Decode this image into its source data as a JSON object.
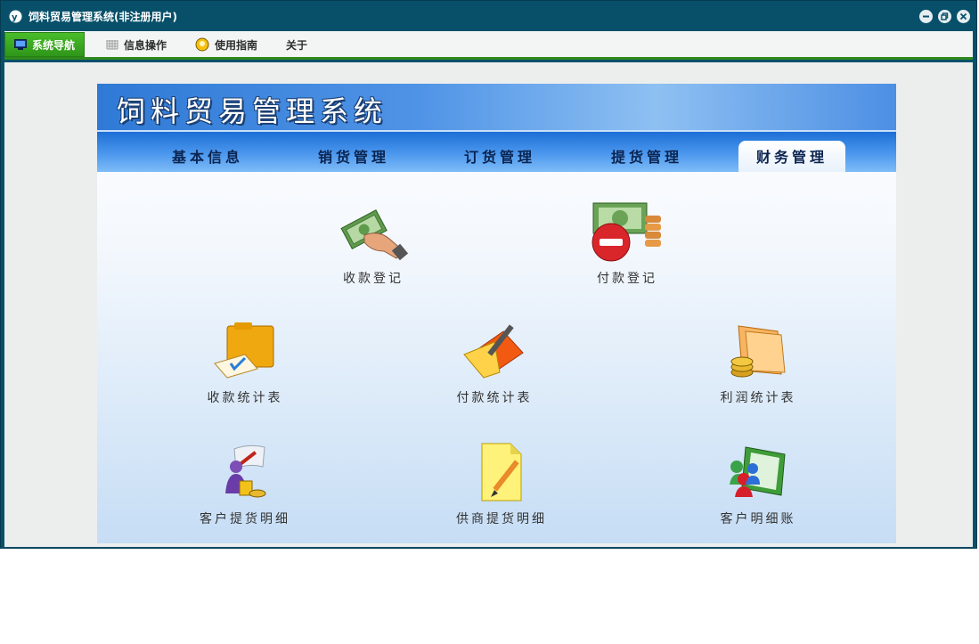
{
  "window": {
    "title": "饲料贸易管理系统(非注册用户)",
    "controls": [
      "minimize-icon",
      "restore-icon",
      "close-icon"
    ]
  },
  "menubar": {
    "items": [
      {
        "label": "系统导航",
        "icon": "monitor-icon",
        "active": true
      },
      {
        "label": "信息操作",
        "icon": "grid-icon",
        "active": false
      },
      {
        "label": "使用指南",
        "icon": "bulb-icon",
        "active": false
      },
      {
        "label": "关于",
        "icon": "",
        "active": false
      }
    ],
    "accent": "#2f8a1c"
  },
  "banner": {
    "title": "饲料贸易管理系统"
  },
  "tabs": [
    {
      "label": "基本信息",
      "active": false
    },
    {
      "label": "销货管理",
      "active": false
    },
    {
      "label": "订货管理",
      "active": false
    },
    {
      "label": "提货管理",
      "active": false
    },
    {
      "label": "财务管理",
      "active": true
    }
  ],
  "finance": {
    "items": [
      {
        "label": "收款登记",
        "icon": "money-hand-icon"
      },
      {
        "label": "付款登记",
        "icon": "money-minus-icon"
      },
      {
        "label": "收款统计表",
        "icon": "folder-check-icon"
      },
      {
        "label": "付款统计表",
        "icon": "folder-pen-icon"
      },
      {
        "label": "利润统计表",
        "icon": "folder-coins-icon"
      },
      {
        "label": "客户提货明细",
        "icon": "person-scroll-icon"
      },
      {
        "label": "供商提货明细",
        "icon": "note-pencil-icon"
      },
      {
        "label": "客户明细账",
        "icon": "ledger-people-icon"
      }
    ]
  }
}
